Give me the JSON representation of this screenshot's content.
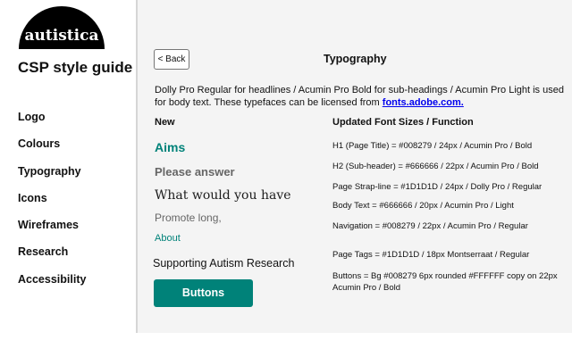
{
  "sidebar": {
    "logo_text": "autistica",
    "title": "CSP style guide",
    "items": [
      {
        "label": "Logo"
      },
      {
        "label": "Colours"
      },
      {
        "label": "Typography"
      },
      {
        "label": "Icons"
      },
      {
        "label": "Wireframes"
      },
      {
        "label": "Research"
      },
      {
        "label": "Accessibility"
      }
    ]
  },
  "header": {
    "back_label": "< Back",
    "title": "Typography"
  },
  "intro": {
    "text": "Dolly Pro Regular for headlines  / Acumin Pro Bold for sub-headings / Acumin Pro Light is used for body text. These typefaces can be licensed from ",
    "link": "fonts.adobe.com."
  },
  "new_column": {
    "heading": "New",
    "samples": {
      "aims": "Aims",
      "please_answer": "Please answer",
      "what_would": "What would you have",
      "promote": "Promote long,",
      "about": "About",
      "supporting": "Supporting Autism Research",
      "button": "Buttons"
    }
  },
  "specs_column": {
    "heading": "Updated Font Sizes / Function",
    "lines": [
      "H1 (Page Title) =  #008279 / 24px / Acumin Pro  / Bold",
      "H2 (Sub-header) =  #666666 / 22px / Acumin Pro / Bold",
      "Page Strap-line = #1D1D1D / 24px / Dolly Pro / Regular",
      "Body Text = #666666 / 20px / Acumin Pro / Light",
      "Navigation = #008279 / 22px / Acumin Pro / Regular",
      "Page Tags = #1D1D1D / 18px Montserraat / Regular",
      "Buttons = Bg #008279 6px rounded #FFFFFF copy on 22px Acumin Pro / Bold"
    ]
  },
  "colors": {
    "teal": "#008279",
    "grey": "#666666",
    "dark": "#1D1D1D",
    "link": "#0000EE"
  }
}
